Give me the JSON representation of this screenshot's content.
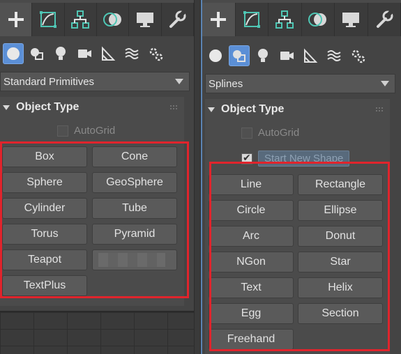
{
  "left_panel": {
    "tabs": [
      "plus-icon",
      "curve-edit-icon",
      "hierarchy-icon",
      "motion-icon",
      "display-icon",
      "wrench-icon"
    ],
    "subtabs": [
      "sphere-icon",
      "shapes-icon",
      "light-icon",
      "camera-icon",
      "helpers-icon",
      "spacewarps-icon",
      "systems-icon"
    ],
    "category": "Standard Primitives",
    "rollout_title": "Object Type",
    "autogrid_label": "AutoGrid",
    "buttons": [
      "Box",
      "Cone",
      "Sphere",
      "GeoSphere",
      "Cylinder",
      "Tube",
      "Torus",
      "Pyramid",
      "Teapot",
      "",
      "TextPlus"
    ]
  },
  "right_panel": {
    "tabs": [
      "plus-icon",
      "curve-edit-icon",
      "hierarchy-icon",
      "motion-icon",
      "display-icon",
      "wrench-icon"
    ],
    "subtabs": [
      "sphere-icon",
      "shapes-icon",
      "light-icon",
      "camera-icon",
      "helpers-icon",
      "spacewarps-icon",
      "systems-icon"
    ],
    "category": "Splines",
    "rollout_title": "Object Type",
    "autogrid_label": "AutoGrid",
    "start_new_shape_label": "Start New Shape",
    "buttons": [
      "Line",
      "Rectangle",
      "Circle",
      "Ellipse",
      "Arc",
      "Donut",
      "NGon",
      "Star",
      "Text",
      "Helix",
      "Egg",
      "Section",
      "Freehand"
    ]
  },
  "colors": {
    "highlight_box": "#e0242c",
    "active_subtab": "#5b8fd6",
    "panel_bg": "#444444",
    "button_bg": "#5a5a5a"
  }
}
